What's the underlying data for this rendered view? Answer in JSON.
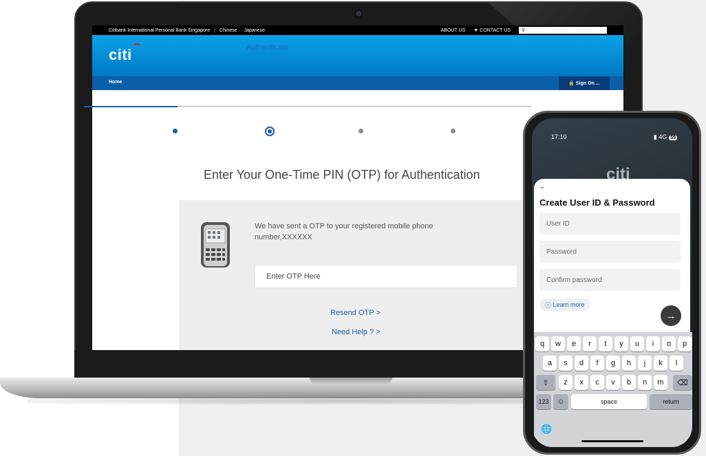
{
  "website": {
    "topbar": {
      "bank_name": "Citibank International Personal Bank Singapore",
      "lang_1": "Chinese",
      "lang_2": "Japanese",
      "about": "ABOUT US",
      "contact": "▼ CONTACT US"
    },
    "logo": "citi",
    "nav": {
      "home": "Home",
      "signon": "Sign On ..."
    },
    "steps": {
      "current_label": "Authenticate"
    },
    "otp": {
      "title": "Enter Your One-Time PIN (OTP) for Authentication",
      "message": "We have sent a OTP to your registered mobile phone number,XXXXXX",
      "input_placeholder": "Enter OTP Here",
      "resend": "Resend OTP >",
      "need_help": "Need Help ? >"
    }
  },
  "phone": {
    "status": {
      "time": "17:10",
      "signal": "4G",
      "battery": "59"
    },
    "logo": "citi",
    "sheet": {
      "title": "Create User ID & Password",
      "user_id_placeholder": "User ID",
      "password_placeholder": "Password",
      "confirm_placeholder": "Confirm password",
      "learn_more": "Learn more"
    },
    "keyboard": {
      "row1": [
        "q",
        "w",
        "e",
        "r",
        "t",
        "y",
        "u",
        "i",
        "o",
        "p"
      ],
      "row2": [
        "a",
        "s",
        "d",
        "f",
        "g",
        "h",
        "j",
        "k",
        "l"
      ],
      "row3": [
        "z",
        "x",
        "c",
        "v",
        "b",
        "n",
        "m"
      ],
      "numbers_key": "123",
      "space_key": "space",
      "return_key": "return"
    }
  },
  "colors": {
    "citi_blue": "#0277c4",
    "nav_blue": "#0b5fa8",
    "link_blue": "#1a5ea6"
  },
  "icons": [
    "search-icon",
    "lock-icon",
    "chevron-down-icon",
    "help-circle-icon",
    "arrow-right-icon",
    "shift-icon",
    "backspace-icon",
    "emoji-icon",
    "globe-icon"
  ]
}
